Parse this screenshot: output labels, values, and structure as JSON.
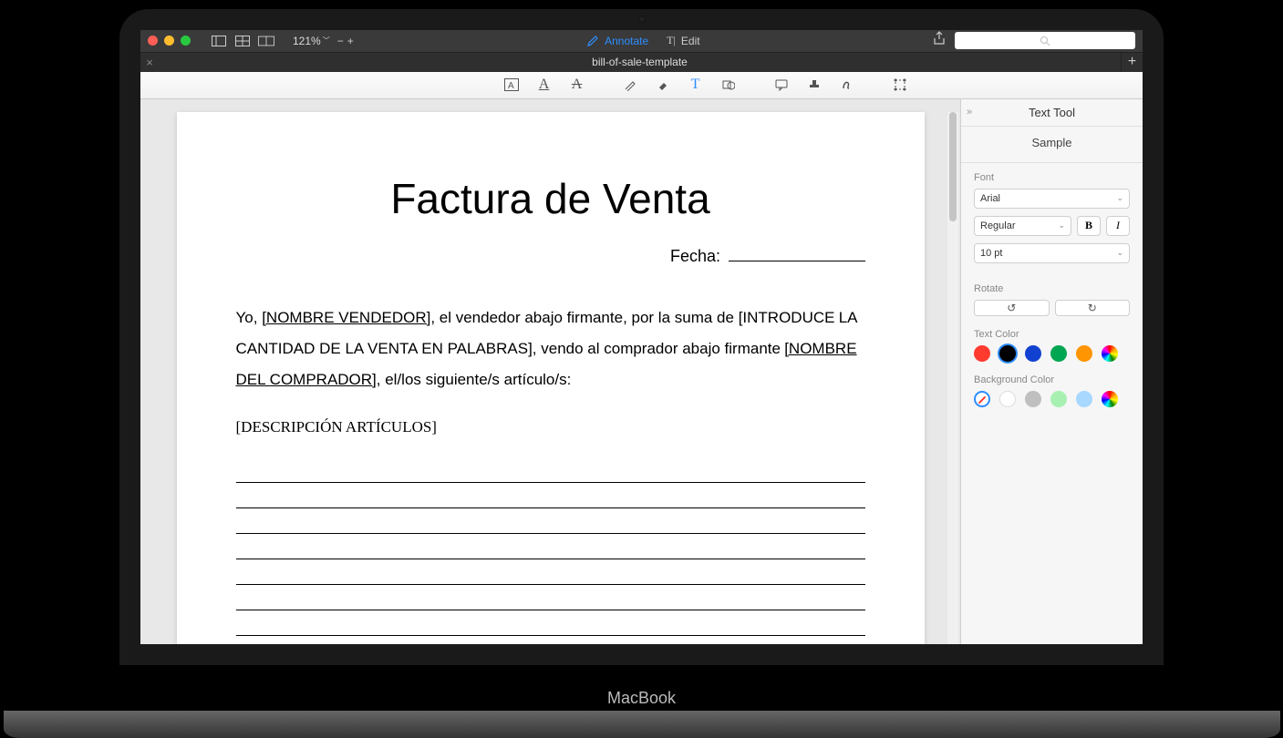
{
  "titlebar": {
    "zoom": "121%",
    "annotate_label": "Annotate",
    "edit_label": "Edit"
  },
  "tab": {
    "title": "bill-of-sale-template"
  },
  "document": {
    "title": "Factura de Venta",
    "fecha_label": "Fecha:",
    "line1a": "Yo, ",
    "placeholder_vendedor": "[NOMBRE VENDEDOR]",
    "line1b": ", el vendedor abajo firmante, por la suma de [INTRODUCE",
    "line2": "LA CANTIDAD DE LA VENTA EN PALABRAS], vendo al comprador abajo firmante",
    "placeholder_comprador": "[NOMBRE DEL COMPRADOR]",
    "line3b": ", el/los siguiente/s artículo/s:",
    "desc_label": "[DESCRIPCIÓN ARTÍCULOS]"
  },
  "sidebar": {
    "title": "Text Tool",
    "sample": "Sample",
    "font_label": "Font",
    "font_family": "Arial",
    "font_style": "Regular",
    "font_size": "10 pt",
    "bold": "B",
    "italic": "I",
    "rotate_label": "Rotate",
    "text_color_label": "Text Color",
    "text_colors": [
      "#ff3b30",
      "#000000",
      "#1141d0",
      "#00a651",
      "#ff9500"
    ],
    "bg_color_label": "Background Color",
    "bg_colors": [
      "#ffffff",
      "#bfbfbf",
      "#a8f0b2",
      "#a8d8ff"
    ]
  }
}
